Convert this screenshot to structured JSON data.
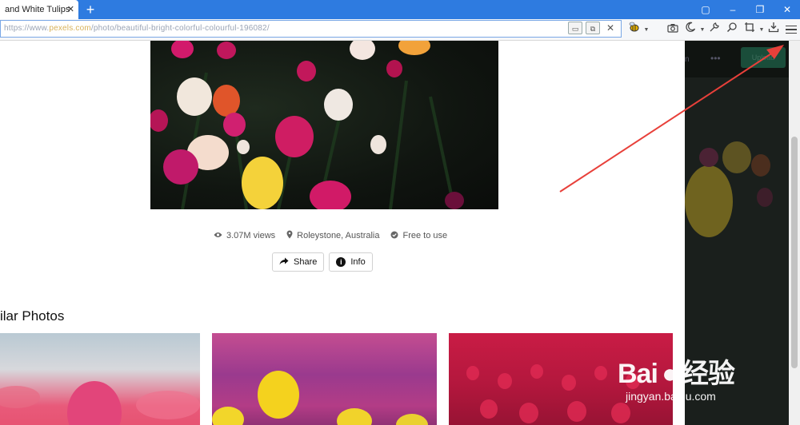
{
  "browser": {
    "tab_title": "and White Tulips",
    "tab_close": "✕",
    "new_tab": "+",
    "window_controls": [
      "▢",
      "–",
      "❐",
      "✕"
    ],
    "url": "https://www.pexels.com/photo/beautiful-bright-colorful-colourful-196082/",
    "url_prefix": "https://www.",
    "url_domain": "pexels.com",
    "url_path": "/photo/beautiful-bright-colorful-colourful-196082/",
    "inner_controls": [
      "▭",
      "⧉",
      "✕"
    ]
  },
  "toolbar_icons": [
    "bee-extension-icon",
    "camera-icon",
    "moon-icon",
    "wrench-icon",
    "search-icon",
    "crop-icon",
    "download-icon",
    "menu-icon"
  ],
  "photo": {
    "views": "3.07M views",
    "location": "Roleystone, Australia",
    "license": "Free to use"
  },
  "actions": {
    "share_label": "Share",
    "info_label": "Info"
  },
  "section": {
    "title": "ilar Photos"
  },
  "dim_area": {
    "upload_label": "Upload",
    "dots": "•••",
    "partial_text": "n"
  },
  "watermark": {
    "brand": "Bai",
    "brand_cn": "经验",
    "url": "jingyan.baidu.com"
  },
  "colors": {
    "titlebar": "#2e7be0",
    "arrow": "#e8403a",
    "upload_button": "#1a4d3a"
  }
}
